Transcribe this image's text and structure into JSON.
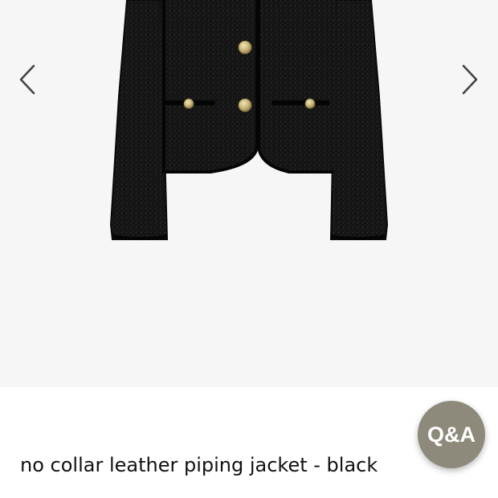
{
  "gallery": {
    "image": {
      "alt": "no collar leather piping jacket - black",
      "jacket_color": "#141414",
      "piping_color": "#0a0a0a",
      "button_color": "#c9b57a"
    },
    "prev_icon": "chevron-left-icon",
    "next_icon": "chevron-right-icon",
    "background": "#f6f6f6"
  },
  "product": {
    "title": "no collar leather piping jacket - black"
  },
  "qa_button": {
    "label": "Q&A",
    "color": "#8d8a7c"
  }
}
